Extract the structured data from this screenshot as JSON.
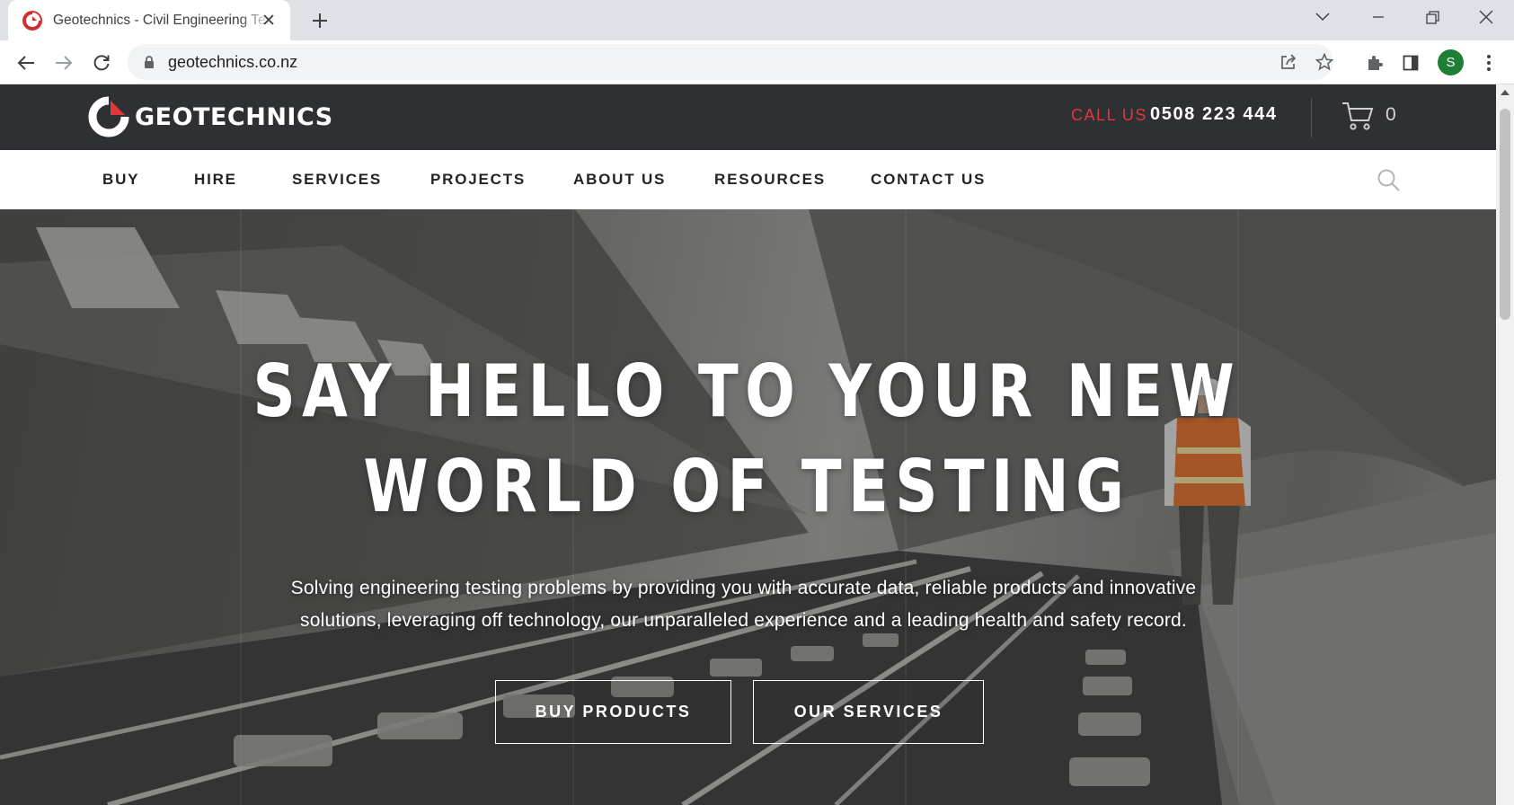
{
  "browser": {
    "tab_title": "Geotechnics - Civil Engineering Testing",
    "url": "geotechnics.co.nz",
    "profile_initial": "S",
    "icons": [
      "favicon",
      "close-icon",
      "plus-icon",
      "chevron-down-icon",
      "minimize-icon",
      "restore-icon",
      "close-window-icon",
      "back-arrow-icon",
      "forward-arrow-icon",
      "reload-icon",
      "lock-icon",
      "share-icon",
      "star-icon",
      "puzzle-icon",
      "side-panel-icon",
      "kebab-menu-icon"
    ]
  },
  "header": {
    "logo_text": "GEOTECHNICS",
    "call_label": "CALL US",
    "phone": "0508 223 444",
    "cart_count": "0",
    "accent_color": "#e0383b",
    "background_color": "#2e3034"
  },
  "nav": {
    "items": [
      "BUY",
      "HIRE",
      "SERVICES",
      "PROJECTS",
      "ABOUT US",
      "RESOURCES",
      "CONTACT US"
    ]
  },
  "hero": {
    "title_line1": "SAY HELLO TO YOUR NEW",
    "title_line2": "WORLD OF TESTING",
    "subtitle_line1": "Solving engineering testing problems by providing you with accurate data, reliable products and innovative",
    "subtitle_line2": "solutions, leveraging off technology, our unparalleled experience and a leading health and safety record.",
    "buttons": [
      "BUY PRODUCTS",
      "OUR SERVICES"
    ]
  }
}
